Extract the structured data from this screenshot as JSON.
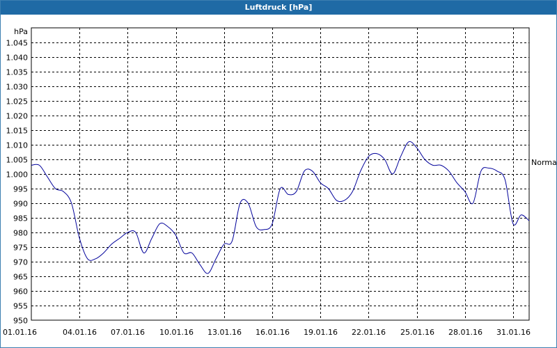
{
  "window": {
    "title": "Luftdruck [hPa]"
  },
  "chart_data": {
    "type": "line",
    "title": "Luftdruck [hPa]",
    "ylabel": "hPa",
    "xlabel": "",
    "reference_label": "Normal",
    "reference_value": 1004,
    "ylim": [
      950,
      1050
    ],
    "y_ticks": [
      950,
      955,
      960,
      965,
      970,
      975,
      980,
      985,
      990,
      995,
      1000,
      1005,
      1010,
      1015,
      1020,
      1025,
      1030,
      1035,
      1040,
      1045
    ],
    "y_tick_labels": [
      "950",
      "955",
      "960",
      "965",
      "970",
      "975",
      "980",
      "985",
      "990",
      "995",
      "1.000",
      "1.005",
      "1.010",
      "1.015",
      "1.020",
      "1.025",
      "1.030",
      "1.035",
      "1.040",
      "1.045"
    ],
    "x_range": [
      "01.01.16",
      "01.02.16"
    ],
    "x_tick_labels": [
      "01.01.16",
      "04.01.16",
      "07.01.16",
      "10.01.16",
      "13.01.16",
      "16.01.16",
      "19.01.16",
      "22.01.16",
      "25.01.16",
      "28.01.16",
      "31.01.16"
    ],
    "grid": true,
    "line_color": "#00009a",
    "series": [
      {
        "x": [
          "01.01.16 00:00",
          "01.01.16 12:00",
          "02.01.16 00:00",
          "02.01.16 12:00",
          "03.01.16 00:00",
          "03.01.16 12:00",
          "04.01.16 00:00",
          "04.01.16 12:00",
          "05.01.16 00:00",
          "05.01.16 12:00",
          "06.01.16 00:00",
          "06.01.16 12:00",
          "07.01.16 00:00",
          "07.01.16 12:00",
          "08.01.16 00:00",
          "08.01.16 12:00",
          "09.01.16 00:00",
          "09.01.16 12:00",
          "10.01.16 00:00",
          "10.01.16 12:00",
          "11.01.16 00:00",
          "11.01.16 12:00",
          "12.01.16 00:00",
          "12.01.16 12:00",
          "13.01.16 00:00",
          "13.01.16 12:00",
          "14.01.16 00:00",
          "14.01.16 12:00",
          "15.01.16 00:00",
          "15.01.16 12:00",
          "16.01.16 00:00",
          "16.01.16 12:00",
          "17.01.16 00:00",
          "17.01.16 12:00",
          "18.01.16 00:00",
          "18.01.16 12:00",
          "19.01.16 00:00",
          "19.01.16 12:00",
          "20.01.16 00:00",
          "20.01.16 12:00",
          "21.01.16 00:00",
          "21.01.16 12:00",
          "22.01.16 00:00",
          "22.01.16 12:00",
          "23.01.16 00:00",
          "23.01.16 12:00",
          "24.01.16 00:00",
          "24.01.16 12:00",
          "25.01.16 00:00",
          "25.01.16 12:00",
          "26.01.16 00:00",
          "26.01.16 12:00",
          "27.01.16 00:00",
          "27.01.16 12:00",
          "28.01.16 00:00",
          "28.01.16 12:00",
          "29.01.16 00:00",
          "29.01.16 12:00",
          "30.01.16 00:00",
          "30.01.16 12:00",
          "31.01.16 00:00",
          "31.01.16 12:00",
          "01.02.16 00:00"
        ],
        "values": [
          1003,
          1003,
          999,
          995,
          994,
          990,
          978,
          971,
          971,
          973,
          976,
          978,
          980,
          980,
          973,
          978,
          983,
          982,
          979,
          973,
          973,
          969,
          966,
          971,
          976,
          977,
          990,
          990,
          982,
          981,
          983,
          995,
          993,
          994,
          1001,
          1001,
          997,
          995,
          991,
          991,
          994,
          1001,
          1006,
          1007,
          1005,
          1000,
          1006,
          1011,
          1009,
          1005,
          1003,
          1003,
          1001,
          997,
          994,
          990,
          1001,
          1002,
          1001,
          998,
          983,
          986,
          984
        ]
      }
    ]
  }
}
